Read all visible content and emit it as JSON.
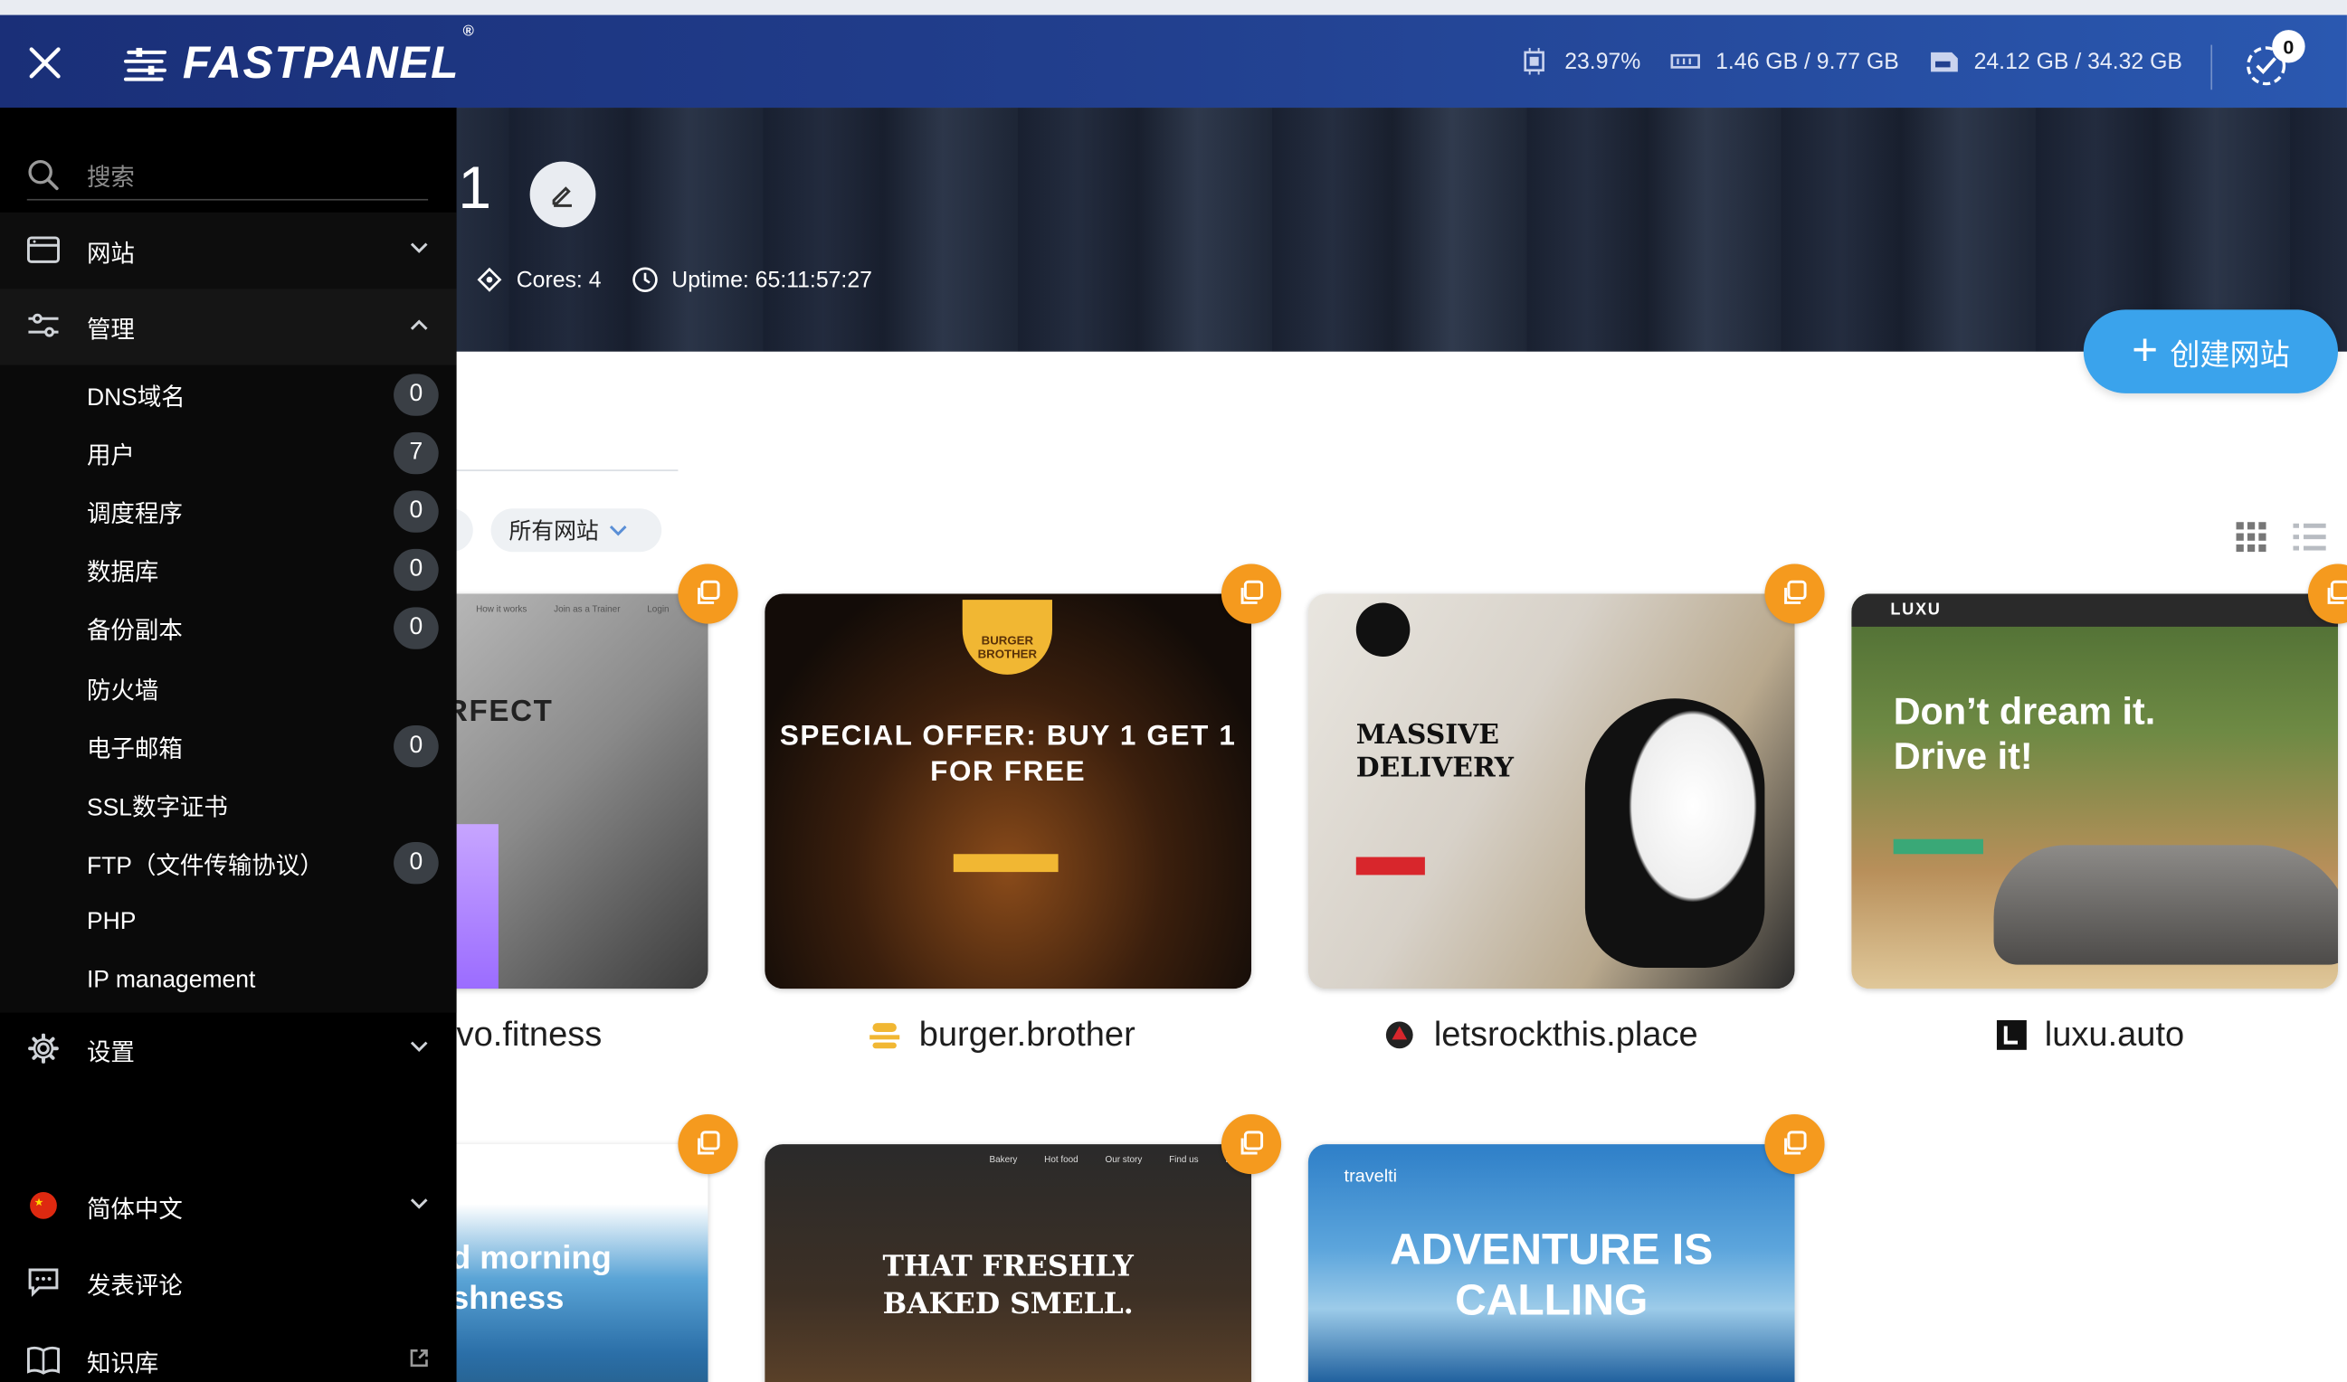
{
  "header": {
    "logo": "FASTPANEL",
    "logo_mark": "®",
    "cpu": "23.97%",
    "ram": "1.46 GB / 9.77 GB",
    "disk": "24.12 GB / 34.32 GB",
    "tasks_count": "0"
  },
  "hero": {
    "title_partial": "1",
    "cores": "Cores: 4",
    "uptime": "Uptime: 65:11:57:27",
    "create_label": "创建网站"
  },
  "filter": {
    "label": "所有网站"
  },
  "sidebar": {
    "search_placeholder": "搜索",
    "groups": {
      "websites": "网站",
      "management": "管理",
      "settings": "设置",
      "language": "简体中文",
      "feedback": "发表评论",
      "knowledge": "知识库"
    },
    "items": [
      {
        "label": "DNS域名",
        "count": "0"
      },
      {
        "label": "用户",
        "count": "7"
      },
      {
        "label": "调度程序",
        "count": "0"
      },
      {
        "label": "数据库",
        "count": "0"
      },
      {
        "label": "备份副本",
        "count": "0"
      },
      {
        "label": "防火墙",
        "count": ""
      },
      {
        "label": "电子邮箱",
        "count": "0"
      },
      {
        "label": "SSL数字证书",
        "count": ""
      },
      {
        "label": "FTP（文件传输协议）",
        "count": "0"
      },
      {
        "label": "PHP",
        "count": ""
      },
      {
        "label": "IP management",
        "count": ""
      }
    ]
  },
  "sites": [
    {
      "name": "vo.fitness",
      "thumb_text": "RFECT"
    },
    {
      "name": "burger.brother",
      "thumb_badge": "BURGER BROTHER",
      "thumb_text": "SPECIAL OFFER: BUY 1 GET 1 FOR FREE"
    },
    {
      "name": "letsrockthis.place",
      "thumb_text": "MASSIVE DELIVERY"
    },
    {
      "name": "luxu.auto",
      "thumb_brand": "LUXU",
      "thumb_text": "Don’t dream it. Drive it!"
    },
    {
      "name": "",
      "thumb_text": "d morning shness"
    },
    {
      "name": "",
      "thumb_text": "THAT FRESHLY BAKED SMELL."
    },
    {
      "name": "",
      "thumb_brand": "travelti",
      "thumb_text": "ADVENTURE IS CALLING"
    }
  ],
  "colors": {
    "accent": "#3aa3ec",
    "copy": "#f59a1e",
    "header": "#22408f",
    "sidebar": "#000000"
  }
}
